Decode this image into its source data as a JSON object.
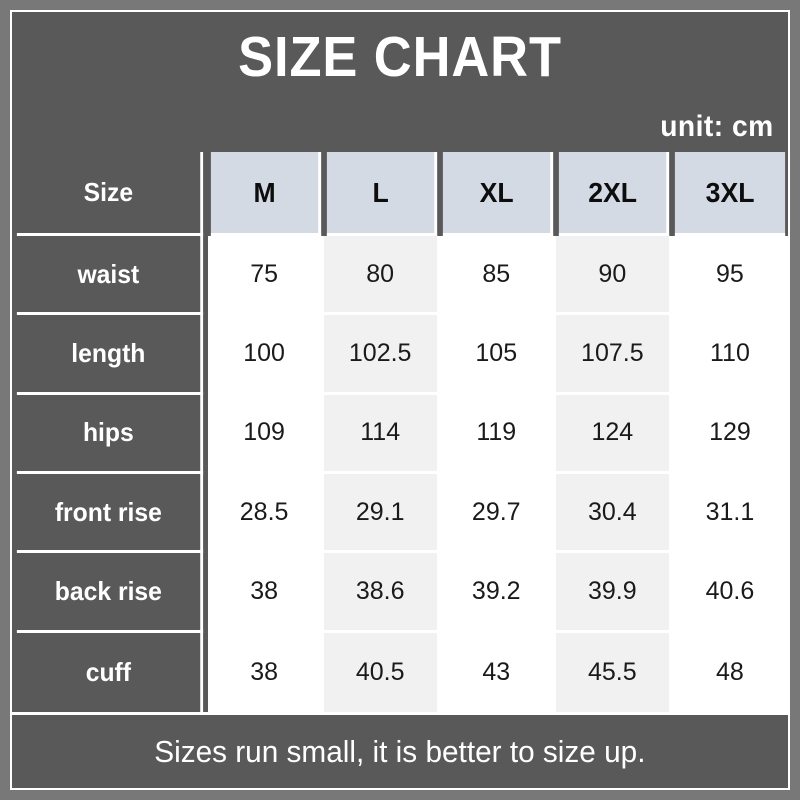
{
  "header": {
    "title": "SIZE CHART",
    "unit_label": "unit: cm"
  },
  "footer": {
    "note": "Sizes run small, it is better to size up."
  },
  "colors": {
    "outer_border": "#787878",
    "dark_panel": "#595959",
    "header_cell": "#d3dae4",
    "shaded_column": "#f1f1f1",
    "cell_background": "#ffffff",
    "grid_line": "#ffffff",
    "dark_text": "#1a1a1a",
    "light_text": "#ffffff"
  },
  "chart_data": {
    "type": "table",
    "title": "SIZE CHART",
    "subtitle": "unit: cm",
    "unit": "cm",
    "row_header_label": "Size",
    "categories": [
      "M",
      "L",
      "XL",
      "2XL",
      "3XL"
    ],
    "measurements": [
      "waist",
      "length",
      "hips",
      "front rise",
      "back rise",
      "cuff"
    ],
    "shaded_columns": [
      1,
      3
    ],
    "series": [
      {
        "name": "waist",
        "values": [
          "75",
          "80",
          "85",
          "90",
          "95"
        ]
      },
      {
        "name": "length",
        "values": [
          "100",
          "102.5",
          "105",
          "107.5",
          "110"
        ]
      },
      {
        "name": "hips",
        "values": [
          "109",
          "114",
          "119",
          "124",
          "129"
        ]
      },
      {
        "name": "front rise",
        "values": [
          "28.5",
          "29.1",
          "29.7",
          "30.4",
          "31.1"
        ]
      },
      {
        "name": "back rise",
        "values": [
          "38",
          "38.6",
          "39.2",
          "39.9",
          "40.6"
        ]
      },
      {
        "name": "cuff",
        "values": [
          "38",
          "40.5",
          "43",
          "45.5",
          "48"
        ]
      }
    ],
    "note": "Sizes run small, it is better to size up."
  }
}
